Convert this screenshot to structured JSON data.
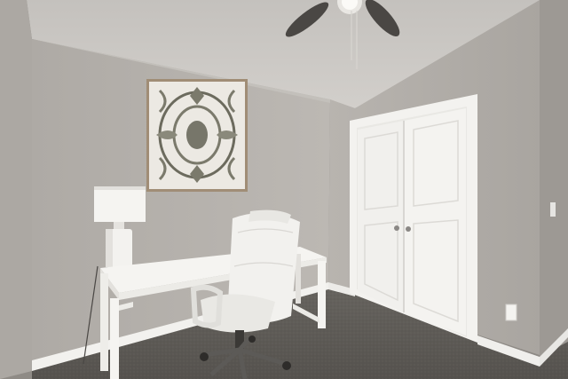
{
  "scene": {
    "kind": "photo",
    "subject": "home-office-room",
    "colors": {
      "wall_left": "#b3afaa",
      "wall_back": "#bab6b1",
      "wall_right": "#b0aca7",
      "ceiling": "#c9c6c2",
      "carpet": "#5e5b57",
      "trim": "#f2f1ee",
      "door": "#f0efec",
      "desk": "#f4f3f0",
      "chair": "#efeeeb",
      "frame": "#a08d76",
      "fan": "#4a4744"
    }
  }
}
